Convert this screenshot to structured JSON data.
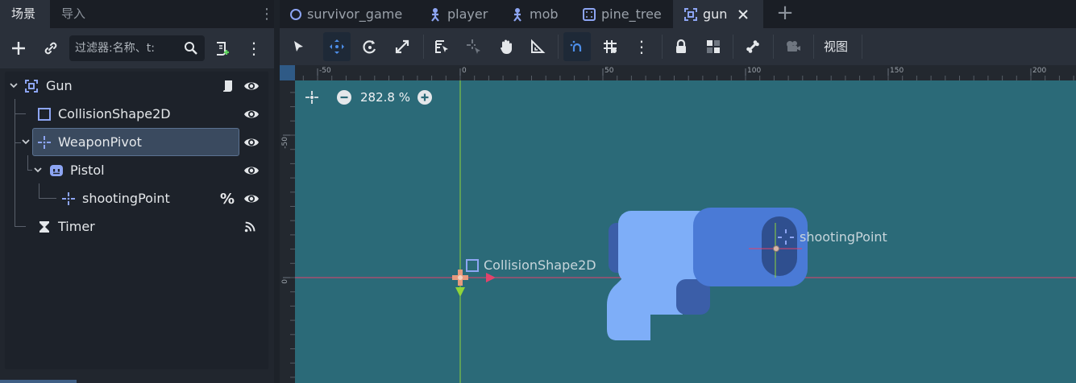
{
  "dock": {
    "tabs": [
      "场景",
      "导入"
    ],
    "filter_placeholder": "过滤器:名称、t:"
  },
  "tree": [
    {
      "label": "Gun"
    },
    {
      "label": "CollisionShape2D"
    },
    {
      "label": "WeaponPivot"
    },
    {
      "label": "Pistol"
    },
    {
      "label": "shootingPoint",
      "extra": "%"
    },
    {
      "label": "Timer"
    }
  ],
  "editor_tabs": [
    "survivor_game",
    "player",
    "mob",
    "pine_tree",
    "gun"
  ],
  "toolbar": {
    "view_menu": "视图"
  },
  "viewport": {
    "zoom": "282.8 %",
    "ruler_top": [
      "-50",
      "0",
      "50",
      "100",
      "150",
      "200"
    ],
    "ruler_left": [
      "-50",
      "0"
    ],
    "labels": {
      "collision": "CollisionShape2D",
      "shooting_point": "shootingPoint"
    }
  },
  "colors": {
    "accent": "#4d8ee8",
    "viewport_bg": "#2b6a78",
    "selection": "#3a4a5f",
    "node2d_icon": "#8da5f3"
  }
}
